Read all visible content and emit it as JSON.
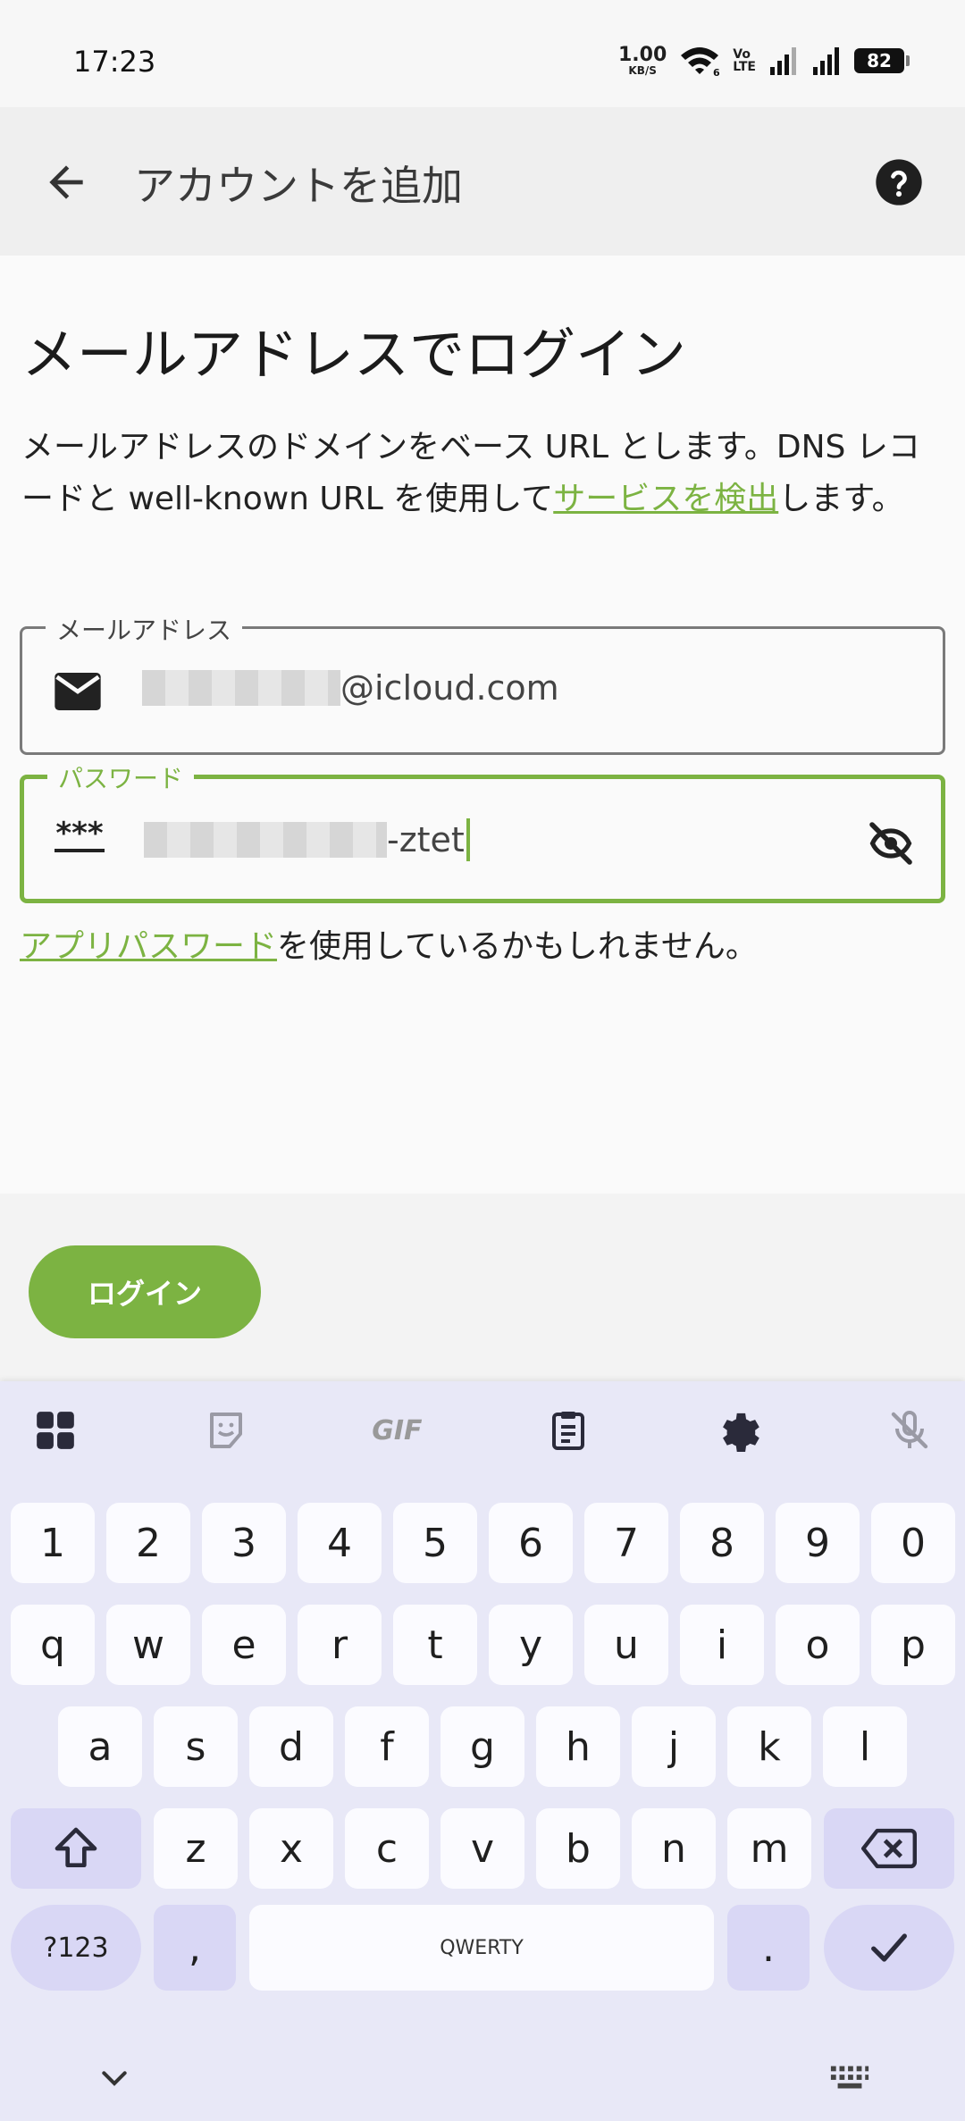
{
  "status_bar": {
    "time": "17:23",
    "net_speed_value": "1.00",
    "net_speed_unit": "KB/S",
    "wifi_label": "6",
    "volte_top": "Vo",
    "volte_bottom": "LTE",
    "battery": "82"
  },
  "app_bar": {
    "title": "アカウントを追加",
    "back_icon": "arrow-left-icon",
    "help_icon": "help-circle-icon"
  },
  "main": {
    "heading": "メールアドレスでログイン",
    "description_before": "メールアドレスのドメインをベース URL とします。DNS レコードと well-known URL を使用して",
    "description_link": "サービスを検出",
    "description_after": "します。",
    "email_field": {
      "label": "メールアドレス",
      "value_visible": "@icloud.com",
      "icon": "mail-icon"
    },
    "password_field": {
      "label": "パスワード",
      "value_visible": "-ztet",
      "icon": "password-icon",
      "icon_text": "***",
      "toggle_icon": "visibility-off-icon"
    },
    "hint_link": "アプリパスワード",
    "hint_after": "を使用しているかもしれません。"
  },
  "actions": {
    "login_label": "ログイン"
  },
  "keyboard": {
    "toolbar": [
      "apps-grid-icon",
      "sticker-icon",
      "gif-icon",
      "clipboard-icon",
      "settings-icon",
      "mic-off-icon"
    ],
    "gif_label": "GIF",
    "row_numbers": [
      "1",
      "2",
      "3",
      "4",
      "5",
      "6",
      "7",
      "8",
      "9",
      "0"
    ],
    "row_top": [
      "q",
      "w",
      "e",
      "r",
      "t",
      "y",
      "u",
      "i",
      "o",
      "p"
    ],
    "row_middle": [
      "a",
      "s",
      "d",
      "f",
      "g",
      "h",
      "j",
      "k",
      "l"
    ],
    "row_bottom": [
      "z",
      "x",
      "c",
      "v",
      "b",
      "n",
      "m"
    ],
    "symbols_label": "?123",
    "comma_label": ",",
    "space_label": "QWERTY",
    "period_label": ".",
    "colors": {
      "background": "#e8e8f7",
      "key": "#fbfbff",
      "function_key": "#d9d7f5"
    }
  },
  "colors": {
    "accent": "#7cb342"
  }
}
